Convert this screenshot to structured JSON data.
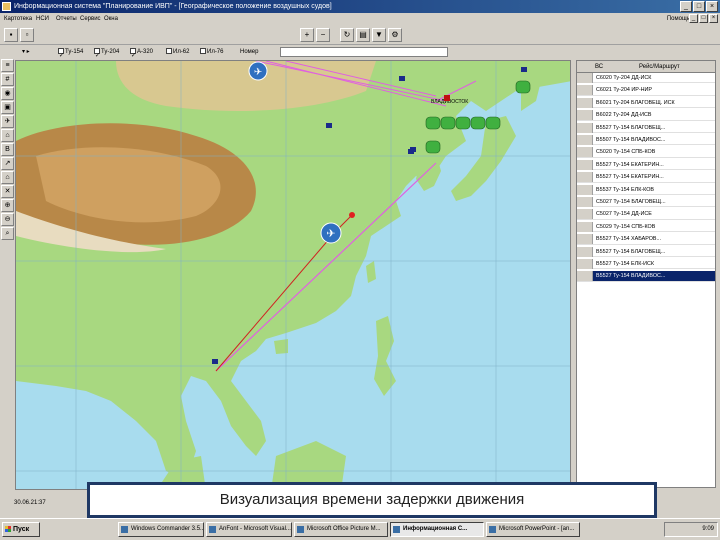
{
  "window": {
    "title": "Информационная система \"Планирование ИВП\" - [Географическое положение воздушных судов]",
    "controls": [
      "_",
      "□",
      "×"
    ]
  },
  "menu": {
    "items": [
      "Картотека",
      "НСИ",
      "Отчеты",
      "Сервис",
      "Окна"
    ],
    "window_item": "Помощь"
  },
  "filters": {
    "items": [
      {
        "label": "Ту-154",
        "checked": true
      },
      {
        "label": "Ту-204",
        "checked": true
      },
      {
        "label": "А-320",
        "checked": true
      },
      {
        "label": "Ил-62",
        "checked": false
      },
      {
        "label": "Ил-76",
        "checked": false
      }
    ],
    "search_label": "Номер"
  },
  "map": {
    "city_label": "ВЛАДИВОСТОК"
  },
  "table": {
    "headers": [
      "ВС",
      "Рейс/Маршрут"
    ],
    "rows": [
      "С6020 Ту-204 ДД-ИСК",
      "С6021 Ту-204 ИР-НИР",
      "В6021 Ту-204 БЛАГОВЕЩ. ИСК",
      "В6022 Ту-204 ДД-ИСВ",
      "В5527 Ту-154 БЛАГОВЕЩ...",
      "В5507 Ту-154 ВЛАДИВОС...",
      "С5020 Ту-154 СПБ-КОВ",
      "В5527 Ту-154 ЕКАТЕРИН...",
      "В5527 Ту-154 ЕКАТЕРИН...",
      "В5537 Ту-154 ЕЛК-КОВ",
      "С5027 Ту-154 БЛАГОВЕЩ...",
      "С5027 Ту-154 ДД-ИСЕ",
      "С5029 Ту-154 СПБ-КОВ",
      "В5527 Ту-154 ХАБАРОВ...",
      "В5527 Ту-154 БЛАГОВЕЩ...",
      "В5527 Ту-154 ЕЛК-ИСК",
      "В5527 Ту-154 ВЛАДИВОС..."
    ]
  },
  "status": {
    "time": "30.06.21:37"
  },
  "caption": "Визуализация времени задержки движения",
  "taskbar": {
    "start": "Пуск",
    "tasks": [
      "Windows Commander 3.5...",
      "AnFont - Microsoft Visual...",
      "Microsoft Office Picture M...",
      "Информационная С...",
      "Microsoft PowerPoint - [an..."
    ],
    "clock": "9:09"
  },
  "colors": {
    "titlebar": "#0a246a",
    "route_magenta": "#e060e0",
    "route_red": "#d02020",
    "sea": "#a8dcee"
  }
}
